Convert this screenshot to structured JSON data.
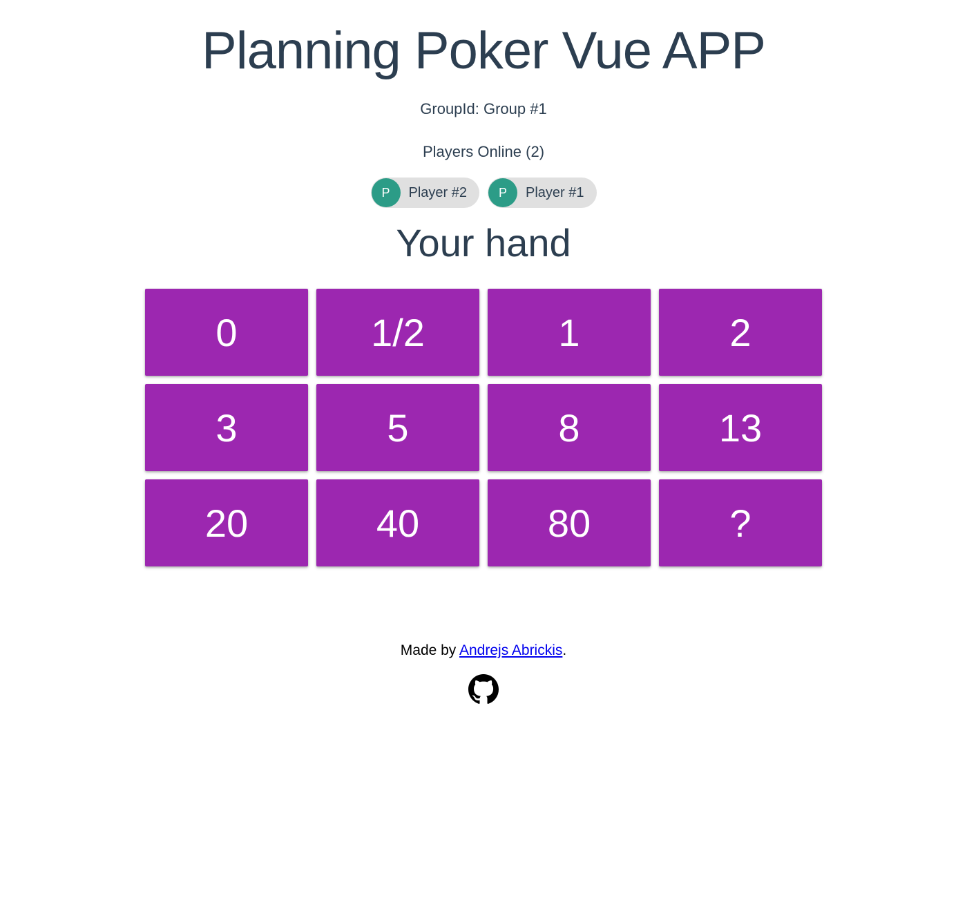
{
  "title": "Planning Poker Vue APP",
  "group": {
    "label": "GroupId: Group #1"
  },
  "players": {
    "heading": "Players Online (2)",
    "list": [
      {
        "initial": "P",
        "name": "Player #2"
      },
      {
        "initial": "P",
        "name": "Player #1"
      }
    ]
  },
  "hand": {
    "heading": "Your hand",
    "cards": [
      "0",
      "1/2",
      "1",
      "2",
      "3",
      "5",
      "8",
      "13",
      "20",
      "40",
      "80",
      "?"
    ]
  },
  "footer": {
    "prefix": "Made by ",
    "link_text": "Andrejs Abrickis",
    "suffix": "."
  },
  "colors": {
    "card_bg": "#9c27b0",
    "avatar_bg": "#2c9c87",
    "chip_bg": "#e0e0e0",
    "text": "#2c3e50",
    "link": "#0000ee"
  }
}
